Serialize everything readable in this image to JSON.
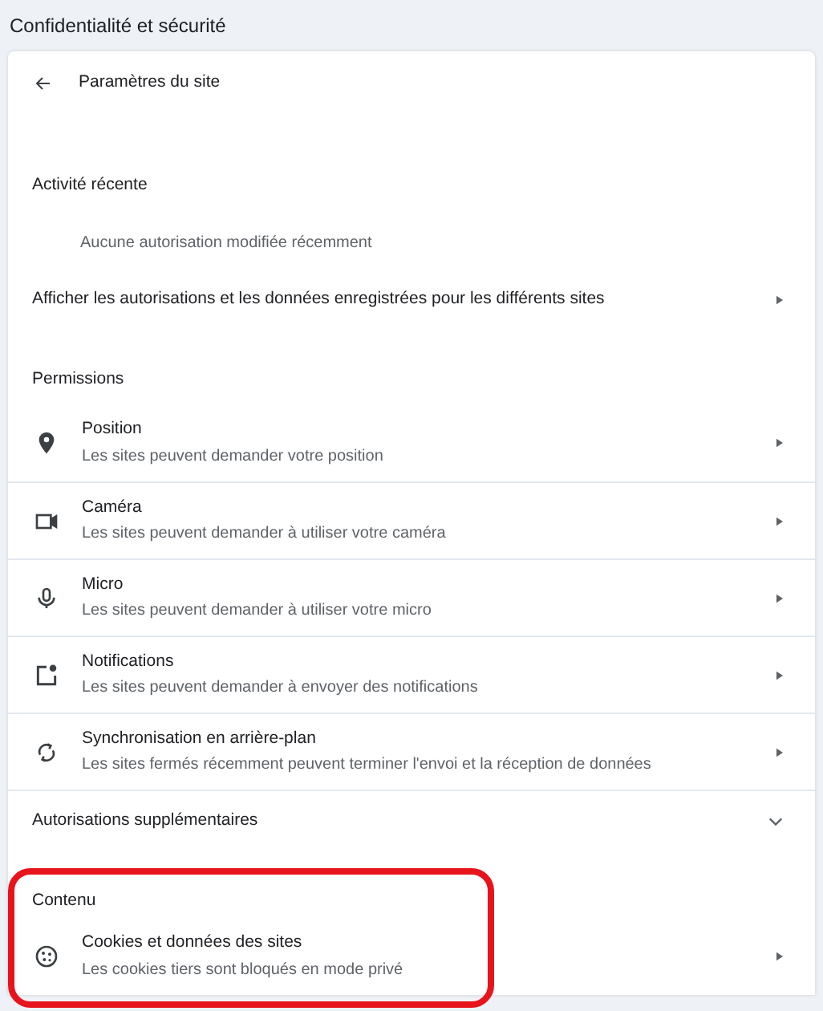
{
  "page_title": "Confidentialité et sécurité",
  "header": {
    "title": "Paramètres du site"
  },
  "recent_activity": {
    "heading": "Activité récente",
    "empty_text": "Aucune autorisation modifiée récemment",
    "link": "Afficher les autorisations et les données enregistrées pour les différents sites"
  },
  "permissions": {
    "heading": "Permissions",
    "items": [
      {
        "kind": "location",
        "title": "Position",
        "description": "Les sites peuvent demander votre position"
      },
      {
        "kind": "camera",
        "title": "Caméra",
        "description": "Les sites peuvent demander à utiliser votre caméra"
      },
      {
        "kind": "mic",
        "title": "Micro",
        "description": "Les sites peuvent demander à utiliser votre micro"
      },
      {
        "kind": "notifications",
        "title": "Notifications",
        "description": "Les sites peuvent demander à envoyer des notifications"
      },
      {
        "kind": "sync",
        "title": "Synchronisation en arrière-plan",
        "description": "Les sites fermés récemment peuvent terminer l'envoi et la réception de données"
      }
    ]
  },
  "additional_permissions": {
    "label": "Autorisations supplémentaires",
    "expanded": false
  },
  "content": {
    "heading": "Contenu",
    "highlighted": true,
    "items": [
      {
        "kind": "cookie",
        "title": "Cookies et données des sites",
        "description": "Les cookies tiers sont bloqués en mode privé"
      }
    ]
  }
}
